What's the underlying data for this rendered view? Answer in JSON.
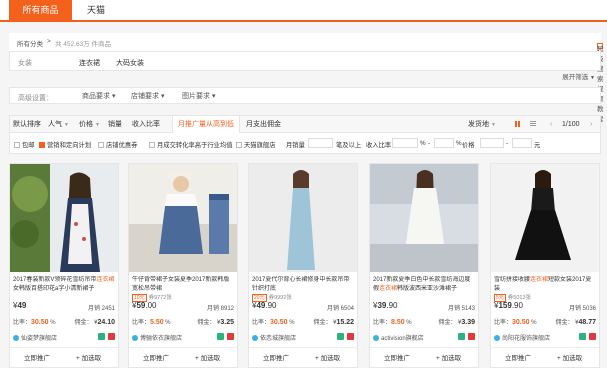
{
  "tabs": {
    "active": "所有商品",
    "inactive": "天猫"
  },
  "crumb": {
    "root": "所有分类",
    "sep": ">",
    "count": "共 452.63万 件商品",
    "adv": "超级搜索视频教程"
  },
  "filter1": {
    "label": "女装",
    "values": [
      "连衣裙",
      "大码女装"
    ]
  },
  "expand": "展开筛选",
  "filter2": {
    "label": "高级设置：",
    "dropdowns": [
      "商品要求",
      "店铺要求",
      "图片要求"
    ]
  },
  "sortbar": {
    "items": [
      "默认排序",
      "人气",
      "价格",
      "销量",
      "收入比率",
      "月推广量从高到低",
      "月支出佣金"
    ],
    "right": "发货地",
    "page": "1/100"
  },
  "opts": {
    "items": [
      "包邮",
      "营销和定向计划",
      "店铺优惠券",
      "月成交转化率高于行业均值",
      "天猫旗舰店",
      "月销量",
      "笔及以上",
      "收入比率",
      "%",
      "价格",
      "元"
    ],
    "dash": "-"
  },
  "products": [
    {
      "title_pre": "2017春装新款V领碎花雪纺吊带",
      "title_kw": "连衣裙",
      "title_post": "女韩版百搭印花a字小清新裙子",
      "promo": "",
      "price": "49",
      "price_frac": "",
      "sales_label": "月销",
      "sales": "2451",
      "rate_label": "比率：",
      "rate": "30.50",
      "comm_label": "佣金：",
      "comm": "24.10",
      "shop": "仙姿梦旗舰店",
      "btn1": "立即推广",
      "btn2": "加选取"
    },
    {
      "title_pre": "牛仔背带裙子女装夏季2017新款韩版宽松吊带裙",
      "title_kw": "",
      "title_post": "",
      "promo": "券9772张",
      "tag": "10元",
      "price": "59",
      "price_frac": ".00",
      "sales_label": "月销",
      "sales": "8912",
      "rate_label": "比率：",
      "rate": "5.50",
      "comm_label": "佣金：",
      "comm": "3.25",
      "shop": "博骊依衣旗舰店",
      "btn1": "立即推广",
      "btn2": "加选取"
    },
    {
      "title_pre": "2017夏代尔背心长裙修身中长款吊带针织打底",
      "title_kw": "",
      "title_post": "",
      "promo": "券9992张",
      "tag": "20元",
      "price": "49",
      "price_frac": ".90",
      "sales_label": "月销",
      "sales": "6504",
      "rate_label": "比率：",
      "rate": "30.50",
      "comm_label": "佣金：",
      "comm": "15.22",
      "shop": "依恋城旗舰店",
      "btn1": "立即推广",
      "btn2": "加选取"
    },
    {
      "title_pre": "2017新款夏季白色中长款雪纺海边度假",
      "title_kw": "连衣裙",
      "title_post": "韩版波西米亚沙滩裙子",
      "promo": "",
      "price": "39",
      "price_frac": ".90",
      "sales_label": "月销",
      "sales": "5143",
      "rate_label": "比率：",
      "rate": "8.50",
      "comm_label": "佣金：",
      "comm": "3.39",
      "shop": "activision旗舰店",
      "btn1": "立即推广",
      "btn2": "加选取"
    },
    {
      "title_pre": "雪纺拼接收腰",
      "title_kw": "连衣裙",
      "title_post": "短款女装2017夏装",
      "promo": "券5013张",
      "tag": "5元",
      "price": "159",
      "price_frac": ".90",
      "sales_label": "月销",
      "sales": "5036",
      "rate_label": "比率：",
      "rate": "30.50",
      "comm_label": "佣金：",
      "comm": "48.77",
      "shop": "尚阳花服饰旗舰店",
      "btn1": "立即推广",
      "btn2": "加选取"
    }
  ],
  "colors": {
    "accent": "#f4611d",
    "green": "#2db37d",
    "red": "#e4393c"
  }
}
